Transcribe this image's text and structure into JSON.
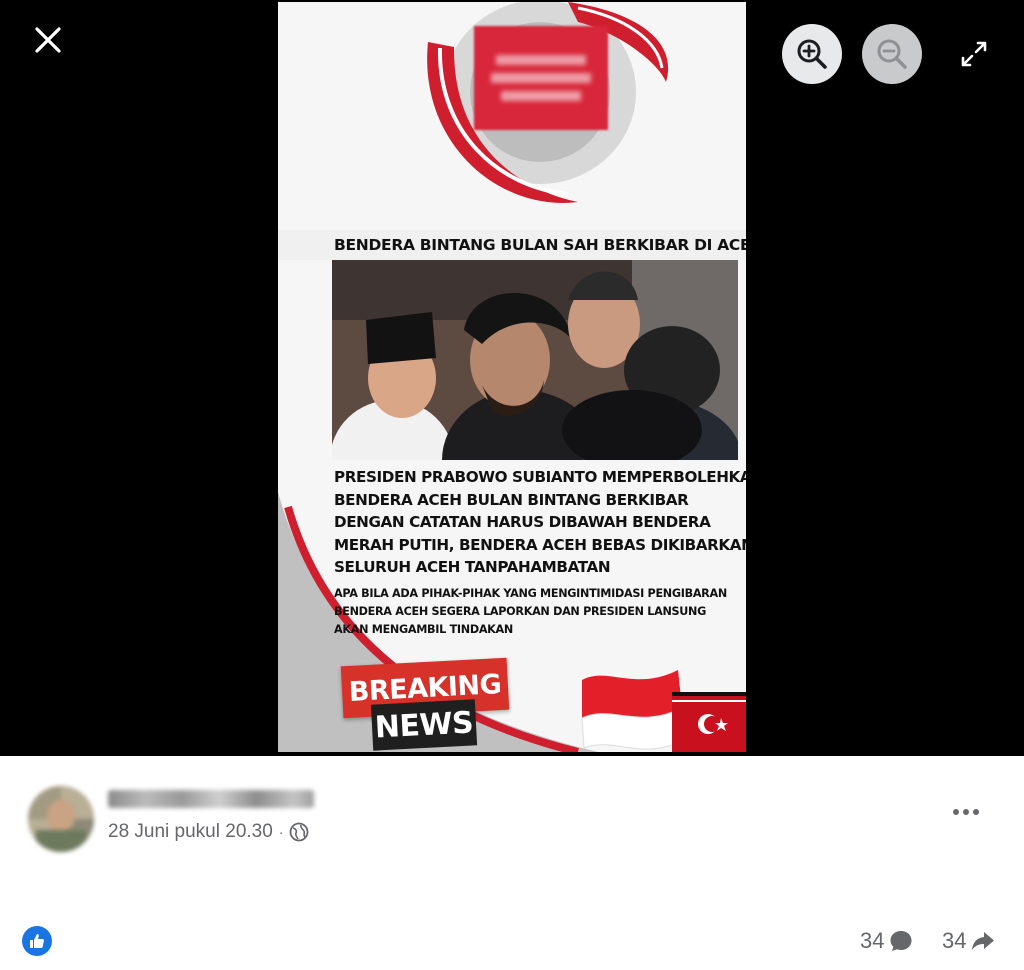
{
  "viewer": {
    "close_icon": "close-icon",
    "zoom_in_icon": "zoom-in-icon",
    "zoom_out_icon": "zoom-out-icon",
    "fullscreen_icon": "fullscreen-icon"
  },
  "image": {
    "headline": "BENDERA BINTANG BULAN SAH BERKIBAR DI ACEH",
    "body_lines": [
      "PRESIDEN PRABOWO SUBIANTO MEMPERBOLEHKAN",
      "BENDERA ACEH BULAN BINTANG BERKIBAR",
      "DENGAN CATATAN HARUS DIBAWAH BENDERA",
      "MERAH PUTIH, BENDERA ACEH BEBAS DIKIBARKAN",
      "SELURUH ACEH TANPAHAMBATAN"
    ],
    "note_lines": [
      "APA BILA ADA PIHAK-PIHAK YANG MENGINTIMIDASI PENGIBARAN",
      "BENDERA ACEH  SEGERA LAPORKAN DAN PRESIDEN LANSUNG",
      "AKAN MENGAMBIL TINDAKAN"
    ],
    "breaking": "BREAKING",
    "news": "NEWS",
    "colors": {
      "accent_red": "#d6322a",
      "banner_dark": "#1f1f1f"
    }
  },
  "post": {
    "timestamp": "28 Juni pukul 20.30",
    "separator": "·",
    "privacy_icon": "globe-icon",
    "more_icon": "more-options-icon",
    "reaction_icon": "like-icon",
    "comment_count": "34",
    "share_count": "34",
    "colors": {
      "like_blue": "#1b74e4",
      "meta_gray": "#65676b"
    }
  }
}
